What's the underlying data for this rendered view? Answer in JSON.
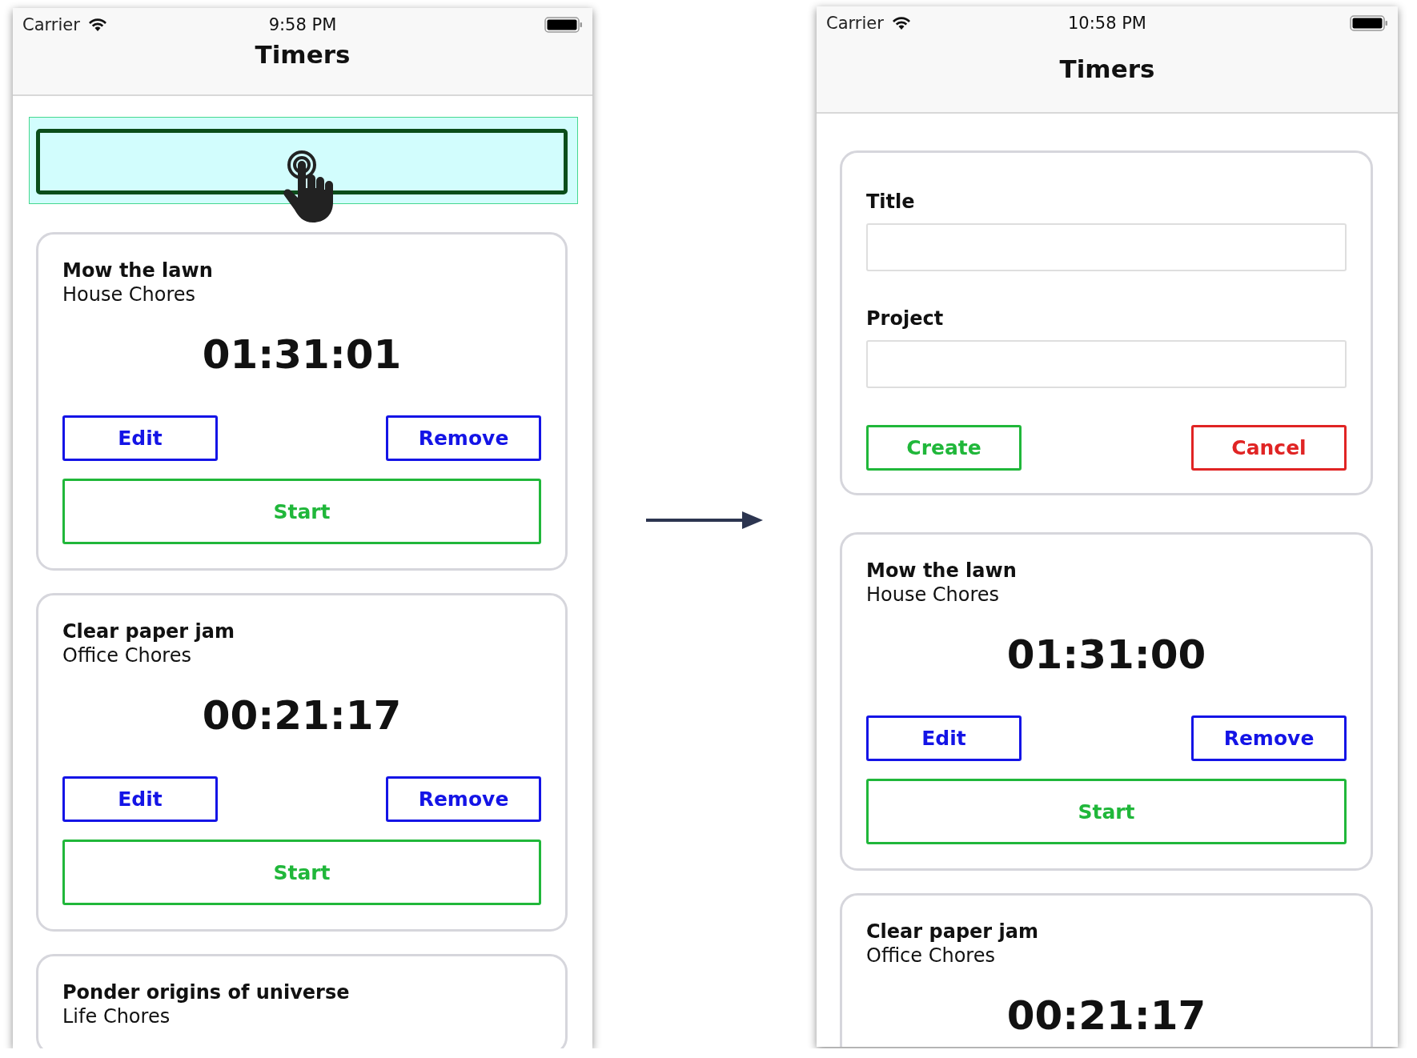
{
  "screens": [
    {
      "status_bar": {
        "carrier": "Carrier",
        "time": "9:58 PM"
      },
      "title": "Timers",
      "content": [
        {
          "kind": "tap_button",
          "highlighted": true
        },
        {
          "kind": "timer",
          "title": "Mow the lawn",
          "project": "House Chores",
          "elapsed": "01:31:01",
          "buttons": [
            {
              "label": "Edit",
              "kind": "half",
              "color": "#1414e6"
            },
            {
              "label": "Remove",
              "kind": "half",
              "color": "#1414e6"
            },
            {
              "label": "Start",
              "kind": "full",
              "color": "#20b73a"
            }
          ]
        },
        {
          "kind": "timer",
          "title": "Clear paper jam",
          "project": "Office Chores",
          "elapsed": "00:21:17",
          "buttons": [
            {
              "label": "Edit",
              "kind": "half",
              "color": "#1414e6"
            },
            {
              "label": "Remove",
              "kind": "half",
              "color": "#1414e6"
            },
            {
              "label": "Start",
              "kind": "full",
              "color": "#20b73a"
            }
          ]
        },
        {
          "kind": "timer",
          "title": "Ponder origins of universe",
          "project": "Life Chores"
        }
      ]
    },
    {
      "status_bar": {
        "carrier": "Carrier",
        "time": "10:58 PM"
      },
      "title": "Timers",
      "content": [
        {
          "kind": "form",
          "fields": [
            {
              "label": "Title"
            },
            {
              "label": "Project"
            }
          ],
          "buttons": [
            {
              "label": "Create",
              "kind": "half",
              "color": "#20b73a"
            },
            {
              "label": "Cancel",
              "kind": "half",
              "color": "#e02424"
            }
          ]
        },
        {
          "kind": "timer",
          "title": "Mow the lawn",
          "project": "House Chores",
          "elapsed": "01:31:00",
          "buttons": [
            {
              "label": "Edit",
              "kind": "half",
              "color": "#1414e6"
            },
            {
              "label": "Remove",
              "kind": "half",
              "color": "#1414e6"
            },
            {
              "label": "Start",
              "kind": "full",
              "color": "#20b73a"
            }
          ]
        },
        {
          "kind": "timer",
          "title": "Clear paper jam",
          "project": "Office Chores",
          "elapsed": "00:21:17"
        }
      ]
    }
  ]
}
